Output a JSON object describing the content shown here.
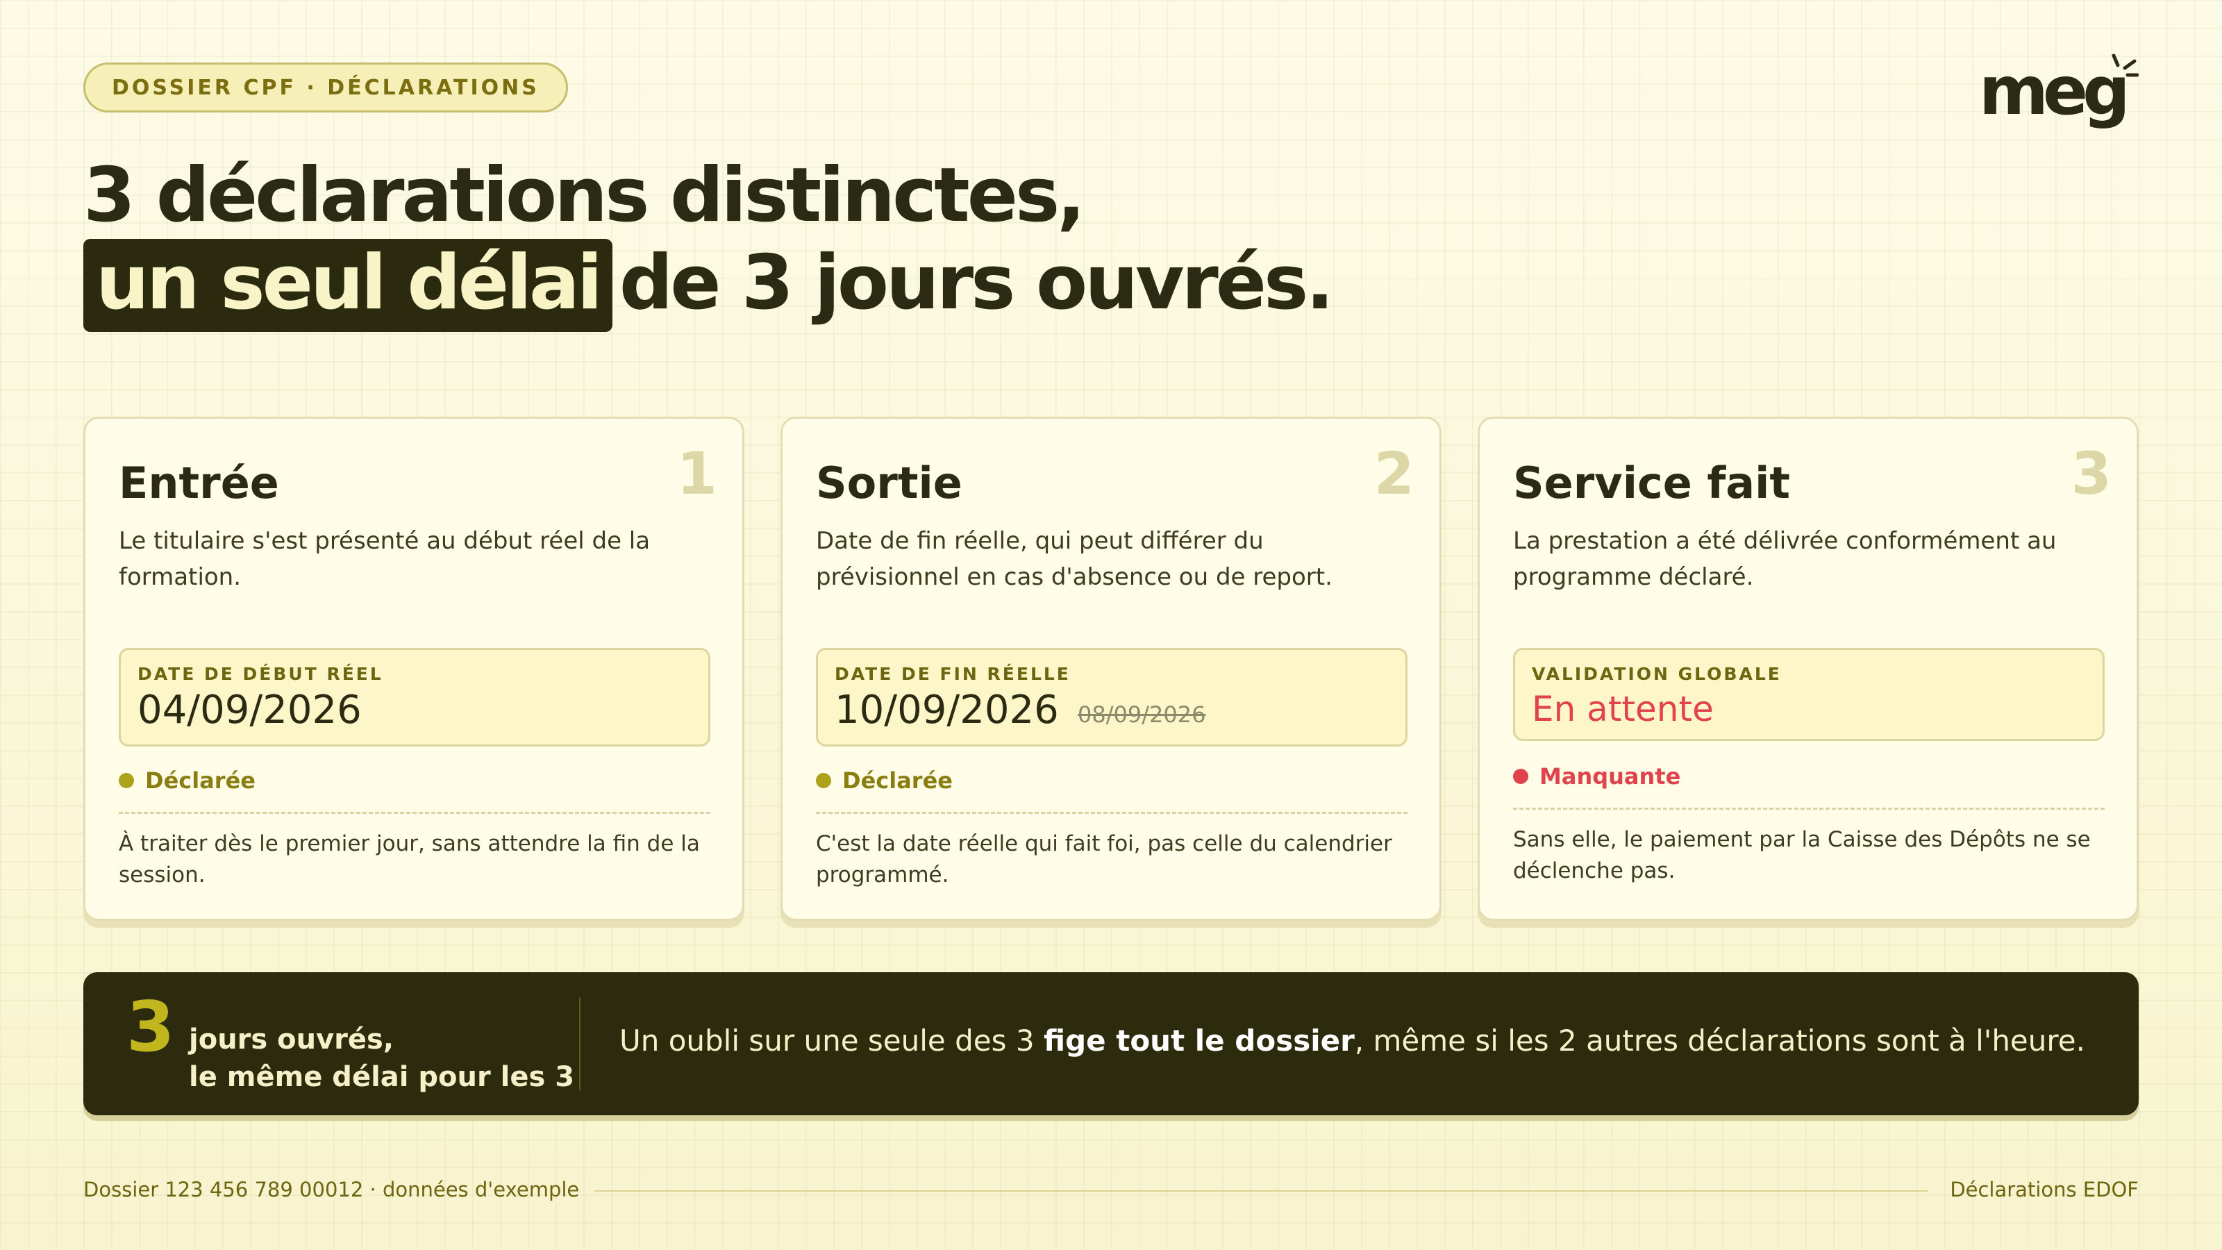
{
  "header": {
    "badge": "DOSSIER CPF · DÉCLARATIONS",
    "logo": "meg",
    "headline_line1": "3 déclarations distinctes,",
    "headline_highlight": "un seul délai",
    "headline_rest": "de 3 jours ouvrés."
  },
  "cards": [
    {
      "number": "1",
      "title": "Entrée",
      "description": "Le titulaire s'est présenté au début réel de la formation.",
      "field_label": "DATE DE DÉBUT RÉEL",
      "field_value": "04/09/2026",
      "status": "Déclarée",
      "note": "À traiter dès le premier jour, sans attendre la fin de la session."
    },
    {
      "number": "2",
      "title": "Sortie",
      "description": "Date de fin réelle, qui peut différer du prévisionnel en cas d'absence ou de report.",
      "field_label": "DATE DE FIN RÉELLE",
      "field_value": "10/09/2026",
      "field_previous": "08/09/2026",
      "status": "Déclarée",
      "note": "C'est la date réelle qui fait foi, pas celle du calendrier programmé."
    },
    {
      "number": "3",
      "title": "Service fait",
      "description": "La prestation a été délivrée conformément au programme déclaré.",
      "field_label": "VALIDATION GLOBALE",
      "field_value": "En attente",
      "status": "Manquante",
      "note": "Sans elle, le paiement par la Caisse des Dépôts ne se déclenche pas."
    }
  ],
  "banner": {
    "big_number": "3",
    "sub_line1": "jours ouvrés,",
    "sub_line2": "le même délai pour les 3",
    "message_before": "Un oubli sur une seule des 3 ",
    "message_bold": "fige tout le dossier",
    "message_after": ", même si les 2 autres déclarations sont à l'heure."
  },
  "footer": {
    "left": "Dossier 123 456 789 00012 · données d'exemple",
    "right": "Déclarations EDOF"
  },
  "colors": {
    "background": "#fbf8d9",
    "dark": "#2b2a0e",
    "accent_olive": "#ada21c",
    "alert_red": "#e0434c"
  }
}
